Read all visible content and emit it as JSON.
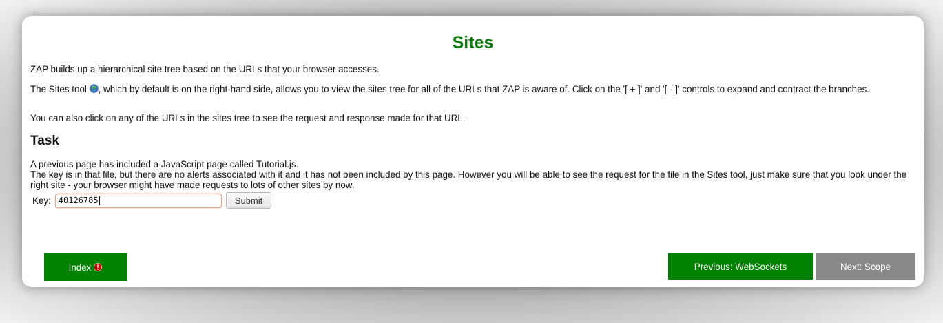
{
  "page": {
    "title": "Sites",
    "intro": "ZAP builds up a hierarchical site tree based on the URLs that your browser accesses.",
    "sites_tool_prefix": "The Sites tool ",
    "sites_tool_suffix": ", which by default is on the right-hand side, allows you to view the sites tree for all of the URLs that ZAP is aware of. Click on the '[ + ]' and '[ - ]' controls to expand and contract the branches.",
    "click_text": "You can also click on any of the URLs in the sites tree to see the request and response made for that URL.",
    "task_heading": "Task",
    "task_line1": "A previous page has included a JavaScript page called Tutorial.js.",
    "task_line2": "The key is in that file, but there are no alerts associated with it and it has not been included by this page. However you will be able to see the request for the file in the Sites tool, just make sure that you look under the right site - your browser might have made requests to lots of other sites by now."
  },
  "form": {
    "key_label": "Key:",
    "key_value": "40126785",
    "submit_label": "Submit"
  },
  "nav": {
    "index_label": "Index",
    "prev_label": "Previous: WebSockets",
    "next_label": "Next: Scope"
  },
  "icons": {
    "sites": "globe-icon",
    "index_alert": "alert-icon"
  },
  "colors": {
    "title": "#0a7d0a",
    "nav_green": "#018200",
    "nav_grey": "#888888"
  }
}
